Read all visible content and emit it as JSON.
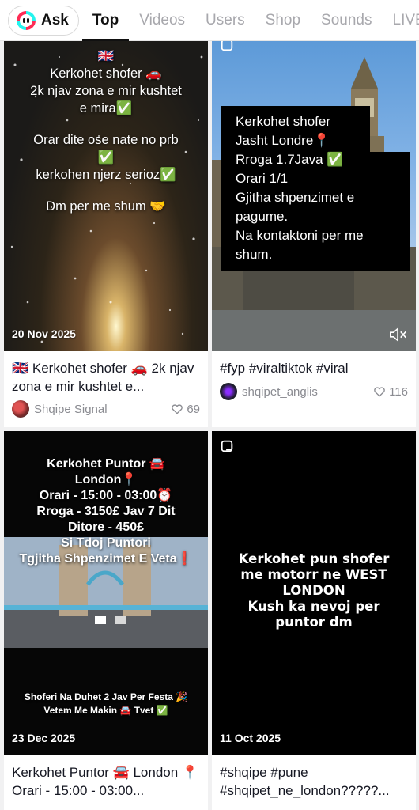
{
  "tabs": {
    "ask_label": "Ask",
    "items": [
      "Top",
      "Videos",
      "Users",
      "Shop",
      "Sounds",
      "LIVE"
    ]
  },
  "cards": [
    {
      "overlay_lines": [
        "🇬🇧",
        "Kerkohet shofer 🚗",
        "2k njav zona e mir kushtet",
        "e mira✅",
        "",
        "Orar dite ose nate no prb",
        "✅",
        "kerkohen njerz serioz✅",
        "",
        "Dm per me shum 🤝"
      ],
      "date": "20 Nov 2025",
      "caption": "🇬🇧 Kerkohet shofer 🚗 2k njav zona e mir kushtet e...",
      "author": "Shqipe Signal",
      "likes": "69"
    },
    {
      "overlay_lines": [
        "Kerkohet shofer",
        "Jasht Londre📍",
        "Rroga 1.7Java ✅",
        "Orari 1/1",
        "Gjitha shpenzimet e",
        "pagume.",
        "Na kontaktoni per me",
        "shum."
      ],
      "caption": "#fyp #viraltiktok #viral",
      "author": "shqipet_anglis",
      "likes": "116"
    },
    {
      "overlay_lines": [
        "Kerkohet Puntor 🚘",
        "London📍",
        "Orari - 15:00 - 03:00⏰",
        "Rroga - 3150£ Jav 7 Dit",
        "Ditore - 450£",
        "Si Tdoj Puntori",
        "Tgjitha Shpenzimet E Veta❗"
      ],
      "bottom_lines": [
        "Shoferi Na Duhet 2 Jav Per Festa 🎉",
        "Vetem Me Makin 🚘 Tvet ✅"
      ],
      "date": "23 Dec 2025",
      "caption": "Kerkohet Puntor 🚘 London 📍 Orari - 15:00 - 03:00..."
    },
    {
      "overlay_lines": [
        "Kerkohet pun shofer",
        "me motorr ne WEST",
        "LONDON",
        "Kush ka nevoj per",
        "puntor dm"
      ],
      "date": "11 Oct 2025",
      "caption": "#shqipe #pune #shqipet_ne_london?????..."
    }
  ],
  "colors": {
    "accent_cyan": "#25f4ee",
    "accent_red": "#fe2c55",
    "text_primary": "#161823",
    "text_secondary": "#8a8b91"
  }
}
